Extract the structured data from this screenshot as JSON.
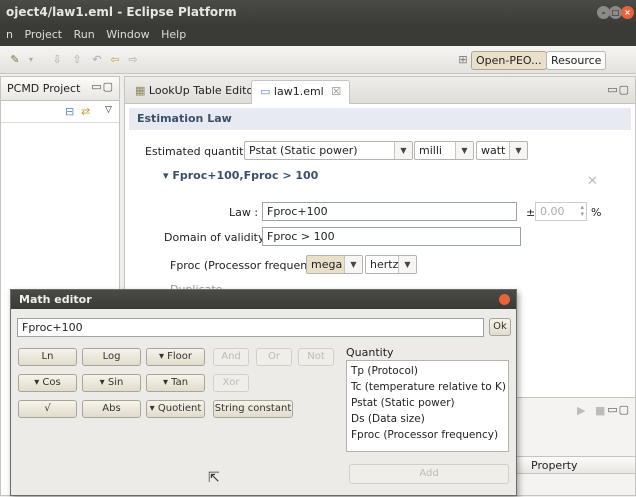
{
  "window": {
    "title": "oject4/law1.eml - Eclipse Platform"
  },
  "menu": [
    "n",
    "Project",
    "Run",
    "Window",
    "Help"
  ],
  "toolbar": {
    "perspectives": [
      "Open-PEO...",
      "Resource"
    ]
  },
  "left_view": {
    "title": "PCMD Project"
  },
  "editor": {
    "tabs": [
      "LookUp Table Editor",
      "law1.eml"
    ],
    "section_title": "Estimation Law",
    "estimated_label": "Estimated quantity :",
    "estimated_value": "Pstat (Static power)",
    "unit_prefix": "milli",
    "unit": "watt",
    "subsection_title": "Fproc+100,Fproc > 100",
    "law_label": "Law :",
    "law_value": "Fproc+100",
    "tolerance_sign": "±",
    "tolerance_value": "0.00",
    "tolerance_unit": "%",
    "domain_label": "Domain of validity :",
    "domain_value": "Fproc > 100",
    "param_label": "Fproc (Processor frequency)",
    "param_prefix": "mega",
    "param_unit": "hertz",
    "duplicate_partial": "Duplicate"
  },
  "bottom_view": {
    "column": "Property"
  },
  "math_editor": {
    "title": "Math editor",
    "expression": "Fproc+100",
    "ok_label": "Ok",
    "buttons": [
      "Ln",
      "Log",
      "▾ Floor",
      "And",
      "Or",
      "Not",
      "▾ Cos",
      "▾ Sin",
      "▾ Tan",
      "Xor",
      "√",
      "Abs",
      "▾ Quotient",
      "String constant"
    ],
    "quantity_label": "Quantity",
    "quantities": [
      "Tp (Protocol)",
      "Tc (temperature relative to K)",
      "Pstat (Static power)",
      "Ds (Data size)",
      "Fproc (Processor frequency)"
    ],
    "add_label": "Add"
  },
  "colors": {
    "title_bar": "#3c3b37",
    "close_button": "#e8633a",
    "section_header": "#39506b"
  }
}
